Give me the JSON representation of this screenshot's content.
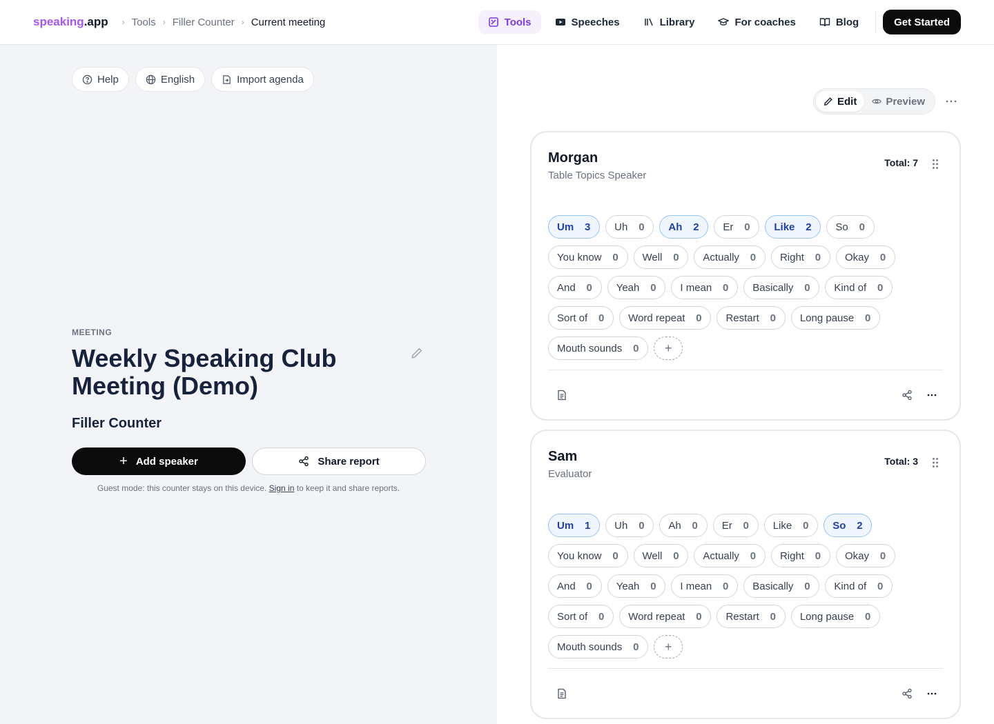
{
  "header": {
    "brand_part1": "speaking",
    "brand_part2": ".app",
    "breadcrumb": [
      "Tools",
      "Filler Counter",
      "Current meeting"
    ],
    "nav": [
      {
        "label": "Tools",
        "icon": "tools-icon",
        "active": true
      },
      {
        "label": "Speeches",
        "icon": "video-icon"
      },
      {
        "label": "Library",
        "icon": "library-icon"
      },
      {
        "label": "For coaches",
        "icon": "graduation-cap-icon"
      },
      {
        "label": "Blog",
        "icon": "book-icon"
      }
    ],
    "cta_label": "Get Started"
  },
  "left": {
    "pills": [
      {
        "label": "Help",
        "icon": "help-circle-icon"
      },
      {
        "label": "English",
        "icon": "globe-icon"
      },
      {
        "label": "Import agenda",
        "icon": "import-file-icon"
      }
    ],
    "meeting_label": "MEETING",
    "meeting_title": "Weekly Speaking Club Meeting (Demo)",
    "tool_title": "Filler Counter",
    "add_speaker_label": "Add speaker",
    "share_report_label": "Share report",
    "guest_text_before": "Guest mode: this counter stays on this device.",
    "guest_link": "Sign in",
    "guest_text_after": "to keep it and share reports."
  },
  "right": {
    "edit_label": "Edit",
    "preview_label": "Preview",
    "speakers": [
      {
        "name": "Morgan",
        "role": "Table Topics Speaker",
        "total": "Total: 7",
        "fillers": [
          {
            "label": "Um",
            "count": 3
          },
          {
            "label": "Uh",
            "count": 0
          },
          {
            "label": "Ah",
            "count": 2
          },
          {
            "label": "Er",
            "count": 0
          },
          {
            "label": "Like",
            "count": 2
          },
          {
            "label": "So",
            "count": 0
          },
          {
            "label": "You know",
            "count": 0
          },
          {
            "label": "Well",
            "count": 0
          },
          {
            "label": "Actually",
            "count": 0
          },
          {
            "label": "Right",
            "count": 0
          },
          {
            "label": "Okay",
            "count": 0
          },
          {
            "label": "And",
            "count": 0
          },
          {
            "label": "Yeah",
            "count": 0
          },
          {
            "label": "I mean",
            "count": 0
          },
          {
            "label": "Basically",
            "count": 0
          },
          {
            "label": "Kind of",
            "count": 0
          },
          {
            "label": "Sort of",
            "count": 0
          },
          {
            "label": "Word repeat",
            "count": 0
          },
          {
            "label": "Restart",
            "count": 0
          },
          {
            "label": "Long pause",
            "count": 0
          },
          {
            "label": "Mouth sounds",
            "count": 0
          }
        ]
      },
      {
        "name": "Sam",
        "role": "Evaluator",
        "total": "Total: 3",
        "fillers": [
          {
            "label": "Um",
            "count": 1
          },
          {
            "label": "Uh",
            "count": 0
          },
          {
            "label": "Ah",
            "count": 0
          },
          {
            "label": "Er",
            "count": 0
          },
          {
            "label": "Like",
            "count": 0
          },
          {
            "label": "So",
            "count": 2
          },
          {
            "label": "You know",
            "count": 0
          },
          {
            "label": "Well",
            "count": 0
          },
          {
            "label": "Actually",
            "count": 0
          },
          {
            "label": "Right",
            "count": 0
          },
          {
            "label": "Okay",
            "count": 0
          },
          {
            "label": "And",
            "count": 0
          },
          {
            "label": "Yeah",
            "count": 0
          },
          {
            "label": "I mean",
            "count": 0
          },
          {
            "label": "Basically",
            "count": 0
          },
          {
            "label": "Kind of",
            "count": 0
          },
          {
            "label": "Sort of",
            "count": 0
          },
          {
            "label": "Word repeat",
            "count": 0
          },
          {
            "label": "Restart",
            "count": 0
          },
          {
            "label": "Long pause",
            "count": 0
          },
          {
            "label": "Mouth sounds",
            "count": 0
          }
        ]
      }
    ]
  },
  "colors": {
    "brand_accent": "#a855f7",
    "active_chip_bg": "#eff6ff",
    "active_chip_border": "#93c5fd",
    "title_color": "#17233d"
  }
}
